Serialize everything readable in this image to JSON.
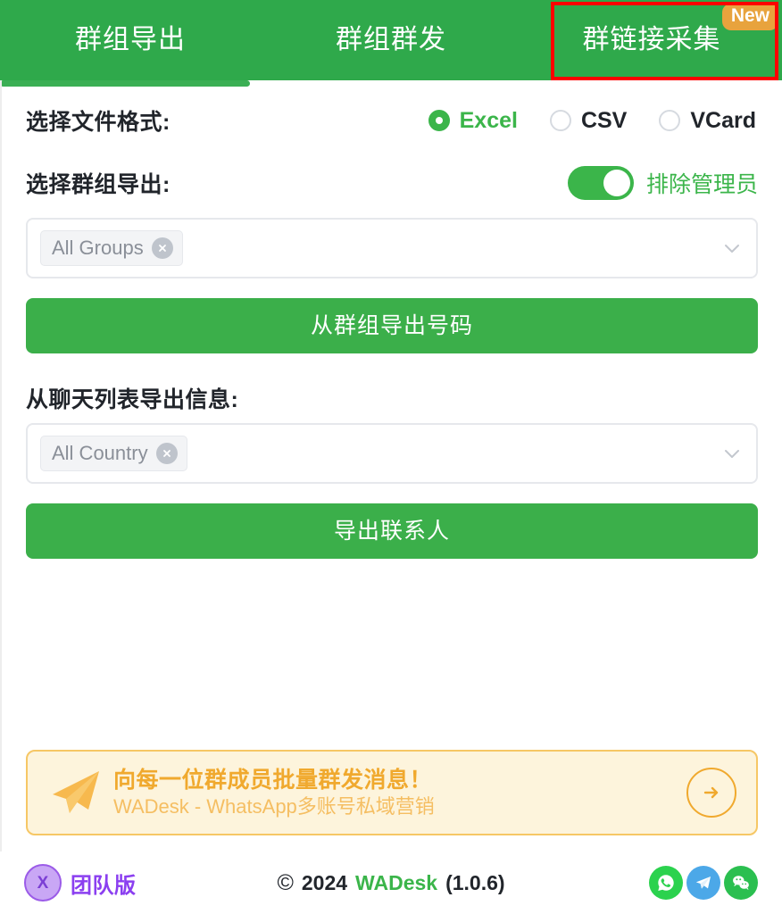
{
  "tabs": [
    {
      "label": "群组导出",
      "active": true,
      "badge": null
    },
    {
      "label": "群组群发",
      "active": false,
      "badge": null
    },
    {
      "label": "群链接采集",
      "active": false,
      "badge": "New"
    }
  ],
  "format_row": {
    "label": "选择文件格式:",
    "options": [
      {
        "label": "Excel",
        "selected": true
      },
      {
        "label": "CSV",
        "selected": false
      },
      {
        "label": "VCard",
        "selected": false
      }
    ]
  },
  "groups_row": {
    "label": "选择群组导出:",
    "toggle_label": "排除管理员",
    "toggle_on": true
  },
  "group_select": {
    "chip": "All Groups",
    "caret": "chevron-down-icon"
  },
  "export_groups_button": {
    "label": "从群组导出号码"
  },
  "chat_section": {
    "label": "从聊天列表导出信息:"
  },
  "country_select": {
    "chip": "All Country",
    "caret": "chevron-down-icon"
  },
  "export_contacts_button": {
    "label": "导出联系人"
  },
  "promo": {
    "icon": "send-plane-icon",
    "title": "向每一位群成员批量群发消息！",
    "subtitle": "WADesk - WhatsApp多账号私域营销",
    "arrow": "arrow-right-circle-icon"
  },
  "footer": {
    "plan_badge_text": "X",
    "plan_label": "团队版",
    "copyright_mark": "©",
    "copyright_year": "2024",
    "brand": "WADesk",
    "version": "(1.0.6)",
    "socials": [
      {
        "name": "whatsapp-icon"
      },
      {
        "name": "telegram-icon"
      },
      {
        "name": "wechat-icon"
      }
    ]
  },
  "colors": {
    "brand_green": "#3BB54A",
    "tabbar_green": "#2FA94B",
    "badge_orange": "#E8A33D",
    "highlight_red": "#FF0000",
    "promo_bg": "#FDF4DC",
    "promo_border": "#F6C765",
    "promo_title": "#F0A92E",
    "plan_purple": "#8B3FF0"
  }
}
